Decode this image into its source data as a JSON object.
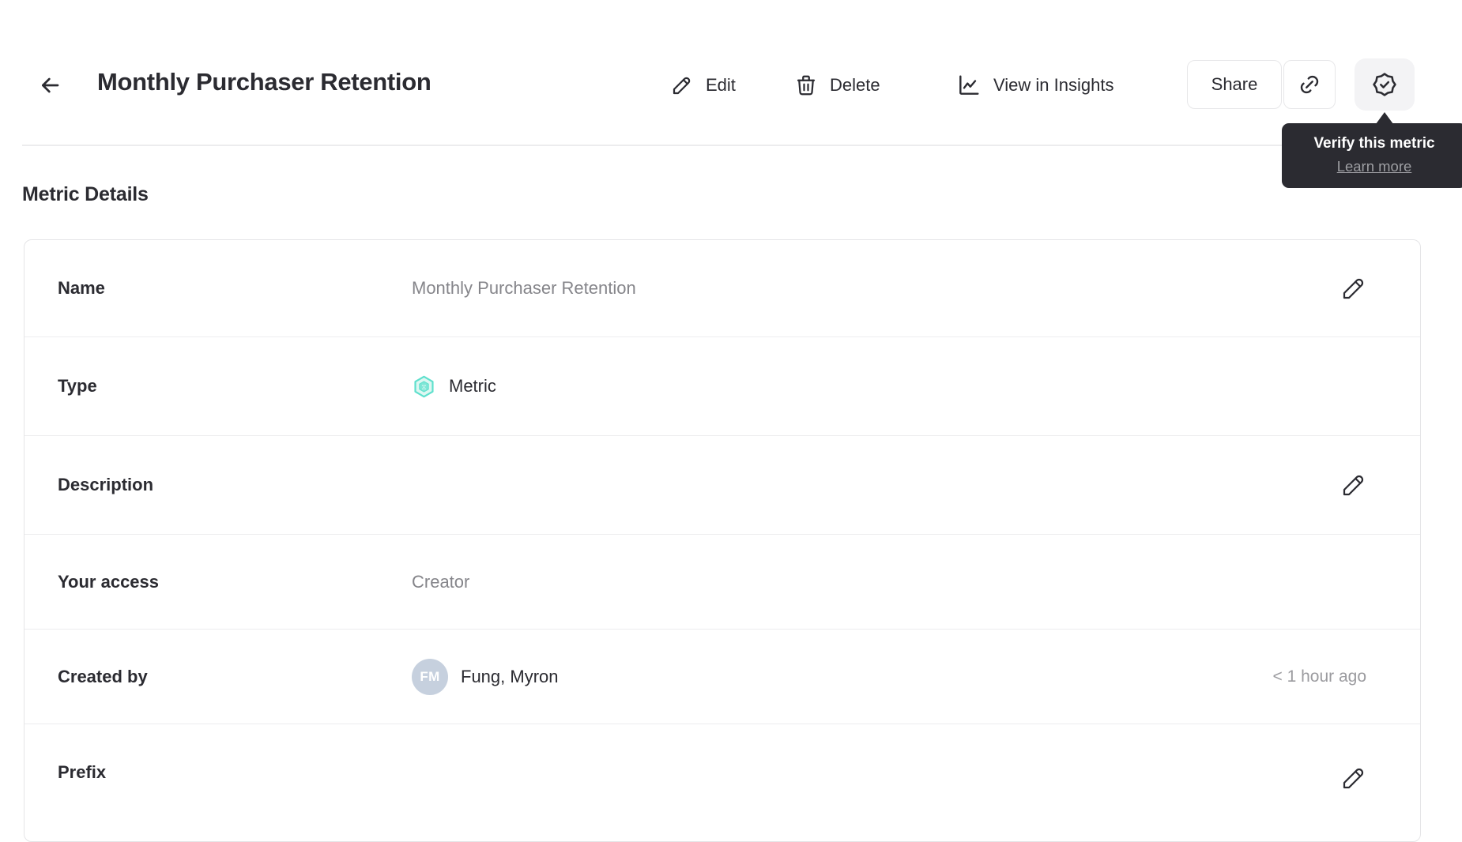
{
  "header": {
    "title": "Monthly Purchaser Retention",
    "actions": {
      "edit": "Edit",
      "delete": "Delete",
      "view_in_insights": "View in Insights",
      "share": "Share"
    },
    "icons": {
      "back": "arrow-left-icon",
      "edit": "pencil-icon",
      "delete": "trash-icon",
      "view_in_insights": "line-chart-icon",
      "copy_link": "link-icon",
      "verify": "verified-badge-icon"
    }
  },
  "verify_tooltip": {
    "title": "Verify this metric",
    "link_label": "Learn more"
  },
  "metric_details": {
    "section_title": "Metric Details",
    "rows": [
      {
        "label": "Name",
        "value": "Monthly Purchaser Retention",
        "editable": true
      },
      {
        "label": "Type",
        "value": "Metric",
        "icon": "metric-hexagon-icon"
      },
      {
        "label": "Description",
        "value": "",
        "editable": true
      },
      {
        "label": "Your access",
        "value": "Creator"
      },
      {
        "label": "Created by",
        "value": "Fung, Myron",
        "avatar_initials": "FM",
        "timestamp": "< 1 hour ago"
      },
      {
        "label": "Prefix",
        "value": "",
        "editable": true
      }
    ]
  },
  "colors": {
    "text_dark": "#2b2b31",
    "text_muted": "#85858a",
    "tooltip_bg": "#2b2b31",
    "accent_teal": "#5fe0cd",
    "accent_teal_fill": "#def7f2",
    "avatar_bg": "#c6d0de",
    "divider": "#ececee",
    "verify_button_bg": "#f3f3f5"
  }
}
